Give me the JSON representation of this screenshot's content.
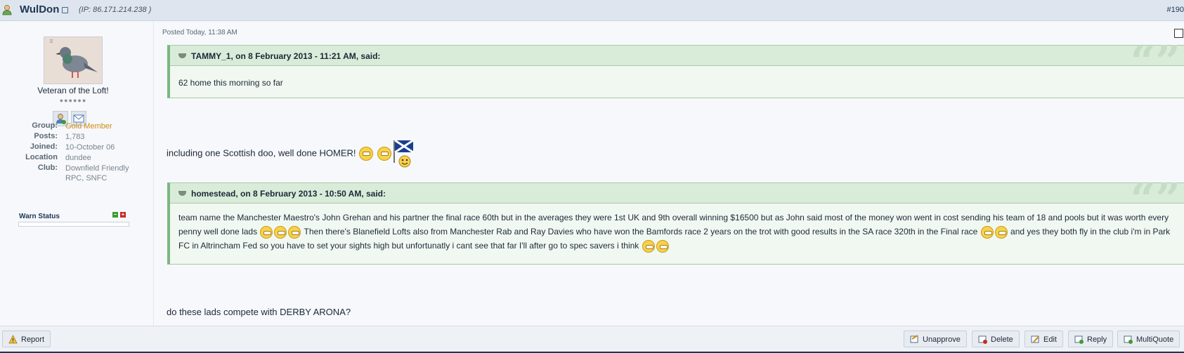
{
  "header": {
    "author": "WulDon",
    "ip": "(IP: 86.171.214.238 )",
    "post_number": "#190"
  },
  "author_panel": {
    "member_title": "Veteran of the Loft!",
    "rank_pips": "●●●●●●",
    "stats": [
      {
        "label": "Group:",
        "value": "Gold Member"
      },
      {
        "label": "Posts:",
        "value": "1,783"
      },
      {
        "label": "Joined:",
        "value": "10-October 06"
      },
      {
        "label": "Location",
        "value": "dundee"
      },
      {
        "label": "Club:",
        "value": "Downfield Friendly RPC, SNFC"
      }
    ],
    "warn_label": "Warn Status"
  },
  "post": {
    "posted_date": "Posted Today, 11:38 AM",
    "quote1": {
      "author_line": "TAMMY_1, on 8 February 2013 - 11:21 AM, said:",
      "text": "62 home this morning so far"
    },
    "line1": "including one Scottish doo, well done HOMER!",
    "quote2": {
      "author_line": "homestead, on 8 February 2013 - 10:50 AM, said:",
      "text_part1": "team name the Manchester Maestro's John Grehan and his partner the final race 60th but in the averages they were 1st UK and 9th overall winning $16500 but as John said most of the money won went in cost sending his team of 18 and pools but it was worth every penny well done lads",
      "text_part2": " Then there's Blanefield Lofts also from Manchester Rab and Ray Davies who have won the Bamfords race 2 years on the trot with good results in the SA race 320th in the Final race",
      "text_part3": " and yes they both fly in the club i'm in Park FC in Altrincham Fed so you have to set your sights high but unfortunatly i cant see that far I'll after go to spec savers i think"
    },
    "line2": "do these lads compete with DERBY ARONA?"
  },
  "footer": {
    "report": "Report",
    "unapprove": "Unapprove",
    "delete": "Delete",
    "edit": "Edit",
    "reply": "Reply",
    "multiquote": "MultiQuote"
  },
  "colors": {
    "header_bg": "#dfe5ee",
    "author_link": "#1d3652",
    "quote_bg": "#f1f8f1",
    "quote_border": "#7bb682",
    "gold_member": "#d28c12"
  },
  "icons": [
    "user-icon",
    "external-link-icon",
    "profile-icon",
    "message-icon",
    "quote-icon",
    "grin-emoji-icon",
    "scotland-flag-smiley-icon",
    "laugh-emoji-icon",
    "warning-icon",
    "unapprove-icon",
    "delete-icon",
    "edit-icon",
    "reply-icon",
    "multiquote-icon"
  ]
}
